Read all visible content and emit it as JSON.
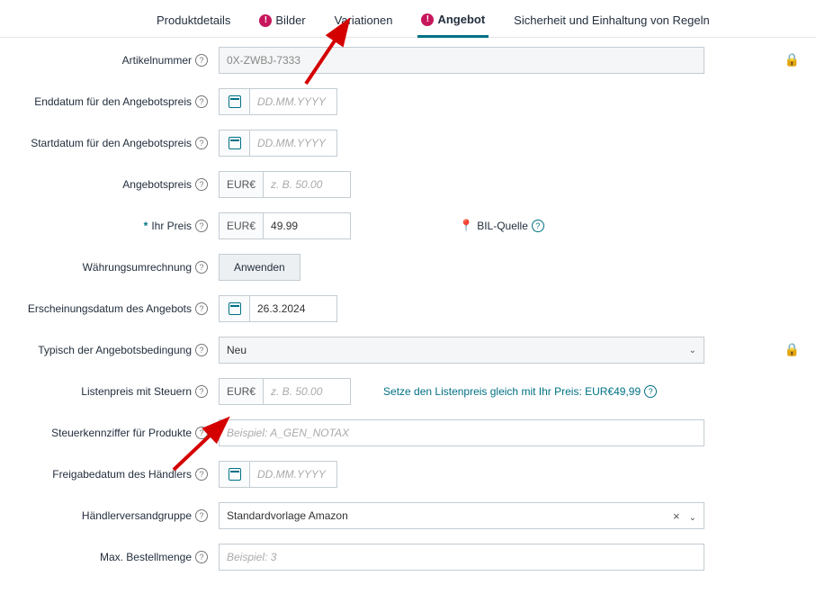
{
  "tabs": {
    "produktdetails": "Produktdetails",
    "bilder": "Bilder",
    "variationen": "Variationen",
    "angebot": "Angebot",
    "sicherheit": "Sicherheit und Einhaltung von Regeln"
  },
  "labels": {
    "artikelnummer": "Artikelnummer",
    "enddatum": "Enddatum für den Angebotspreis",
    "startdatum": "Startdatum für den Angebotspreis",
    "angebotspreis": "Angebotspreis",
    "ihrpreis": "Ihr Preis",
    "waehrungsumrechnung": "Währungsumrechnung",
    "erscheinungsdatum": "Erscheinungsdatum des Angebots",
    "typisch": "Typisch der Angebotsbedingung",
    "listenpreis": "Listenpreis mit Steuern",
    "steuerkennziffer": "Steuerkennziffer für Produkte",
    "freigabedatum": "Freigabedatum des Händlers",
    "versandgruppe": "Händlerversandgruppe",
    "maxbestellmenge": "Max. Bestellmenge"
  },
  "values": {
    "artikelnummer": "0X-ZWBJ-7333",
    "currency": "EUR€",
    "ihrpreis": "49.99",
    "erscheinungsdatum": "26.3.2024",
    "typisch": "Neu",
    "versandgruppe": "Standardvorlage Amazon"
  },
  "placeholders": {
    "date": "DD.MM.YYYY",
    "money": "z. B. 50.00",
    "steuerkennziffer": "Beispiel: A_GEN_NOTAX",
    "maxbestellmenge": "Beispiel: 3"
  },
  "actions": {
    "anwenden": "Anwenden",
    "bilquelle": "BIL-Quelle",
    "listenpreis_link": "Setze den Listenpreis gleich mit Ihr Preis: EUR€49,99"
  }
}
